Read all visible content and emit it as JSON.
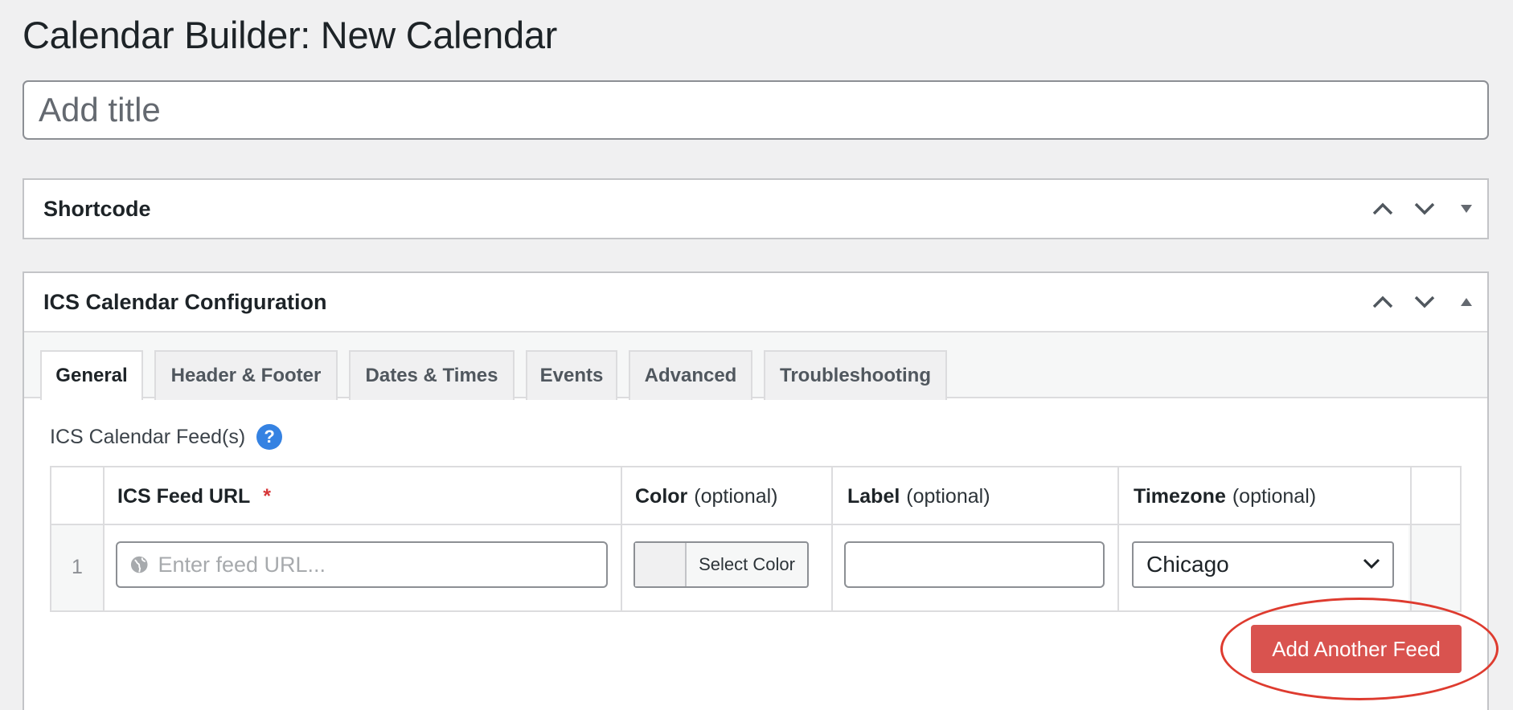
{
  "page": {
    "title": "Calendar Builder: New Calendar"
  },
  "title_field": {
    "placeholder": "Add title"
  },
  "shortcode_box": {
    "title": "Shortcode"
  },
  "config_box": {
    "title": "ICS Calendar Configuration",
    "tabs": [
      {
        "label": "General",
        "active": true
      },
      {
        "label": "Header & Footer",
        "active": false
      },
      {
        "label": "Dates & Times",
        "active": false
      },
      {
        "label": "Events",
        "active": false
      },
      {
        "label": "Advanced",
        "active": false
      },
      {
        "label": "Troubleshooting",
        "active": false
      }
    ],
    "feeds_label": "ICS Calendar Feed(s)",
    "help_glyph": "?",
    "table": {
      "headers": {
        "url": {
          "bold": "ICS Feed URL",
          "required": "*"
        },
        "color": {
          "bold": "Color",
          "opt": "(optional)"
        },
        "label": {
          "bold": "Label",
          "opt": "(optional)"
        },
        "timezone": {
          "bold": "Timezone",
          "opt": "(optional)"
        }
      },
      "rows": [
        {
          "num": "1",
          "url_placeholder": "Enter feed URL...",
          "url_value": "",
          "color_button": "Select Color",
          "label_value": "",
          "timezone": "Chicago"
        }
      ]
    },
    "add_button": "Add Another Feed"
  },
  "colors": {
    "accent_button": "#d9534f",
    "help_icon": "#3582e2",
    "highlight_ring": "#de3b2f",
    "required": "#d63638"
  },
  "icons": {
    "move_up": "chevron-up-icon",
    "move_down": "chevron-down-icon",
    "toggle": "triangle-icon",
    "globe": "globe-icon",
    "select_arrow": "chevron-down-icon"
  }
}
